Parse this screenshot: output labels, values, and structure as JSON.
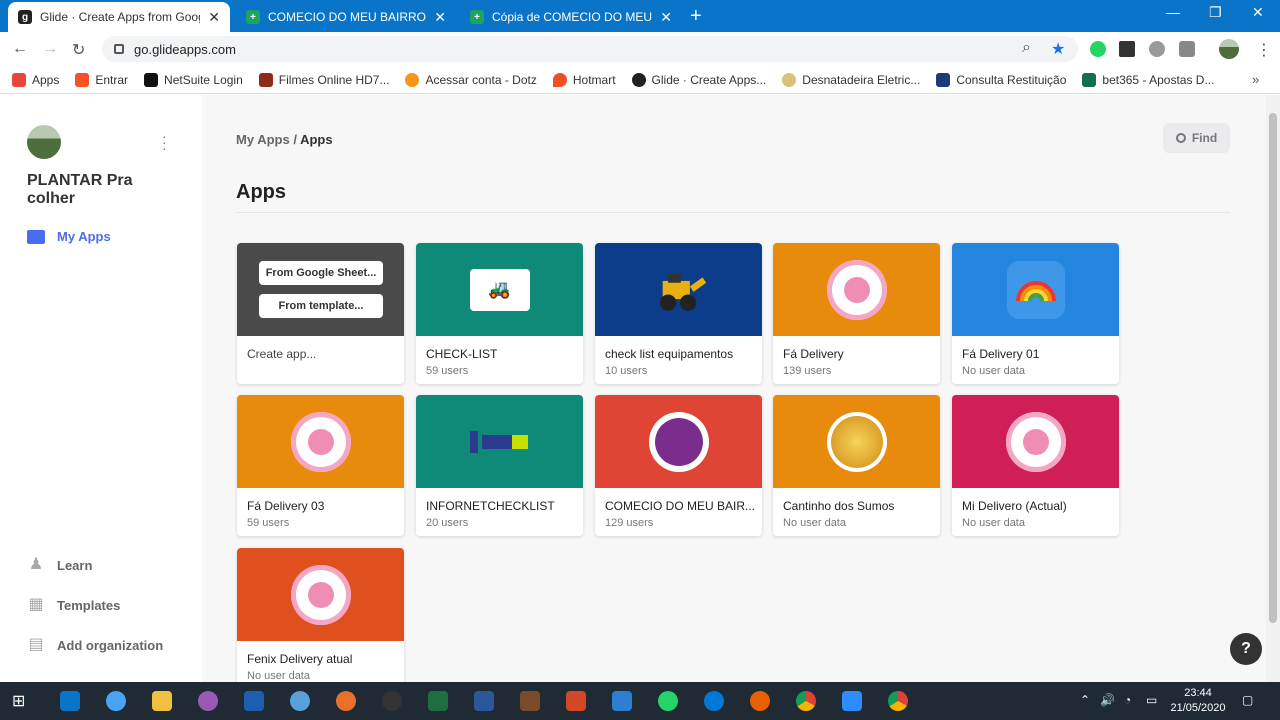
{
  "browser": {
    "tabs": [
      {
        "title": "Glide · Create Apps from Google",
        "favicon": "glide-icon",
        "active": true
      },
      {
        "title": "COMECIO DO MEU BAIRRO - Pla",
        "favicon": "sheets-icon",
        "active": false
      },
      {
        "title": "Cópia de COMECIO DO MEU BAI",
        "favicon": "sheets-icon",
        "active": false
      }
    ],
    "url": "go.glideapps.com",
    "bookmarks": [
      {
        "label": "Apps",
        "icon": "apps-grid-icon",
        "color": "#e8453c"
      },
      {
        "label": "Entrar",
        "icon": "microsoft-icon",
        "color": "#f35325"
      },
      {
        "label": "NetSuite Login",
        "icon": "netsuite-icon",
        "color": "#111111"
      },
      {
        "label": "Filmes Online HD7...",
        "icon": "film-icon",
        "color": "#8b2d1b"
      },
      {
        "label": "Acessar conta - Dotz",
        "icon": "dotz-icon",
        "color": "#f7941d"
      },
      {
        "label": "Hotmart",
        "icon": "hotmart-icon",
        "color": "#f04e23"
      },
      {
        "label": "Glide · Create Apps...",
        "icon": "glide-icon",
        "color": "#222222"
      },
      {
        "label": "Desnatadeira Eletric...",
        "icon": "bowl-icon",
        "color": "#d9c27a"
      },
      {
        "label": "Consulta Restituição",
        "icon": "receita-icon",
        "color": "#1f3a7a"
      },
      {
        "label": "bet365 - Apostas D...",
        "icon": "bet365-icon",
        "color": "#126e51"
      }
    ]
  },
  "sidebar": {
    "org_name": "PLANTAR Pra colher",
    "my_apps_label": "My Apps",
    "bottom_items": [
      {
        "label": "Learn",
        "icon": "learn-icon"
      },
      {
        "label": "Templates",
        "icon": "templates-icon"
      },
      {
        "label": "Add organization",
        "icon": "add-organization-icon"
      }
    ]
  },
  "header": {
    "breadcrumb_root": "My Apps",
    "breadcrumb_sep": " / ",
    "breadcrumb_current": "Apps",
    "find_label": "Find",
    "page_title": "Apps"
  },
  "create_card": {
    "from_sheet_label": "From Google Sheet...",
    "from_template_label": "From template...",
    "label": "Create app..."
  },
  "apps": [
    {
      "name": "CHECK-LIST",
      "users": "59 users",
      "bg": "#0f8a78"
    },
    {
      "name": "check list equipamentos",
      "users": "10 users",
      "bg": "#0c3d8a"
    },
    {
      "name": "Fá Delivery",
      "users": "139 users",
      "bg": "#e88b0c"
    },
    {
      "name": "Fá Delivery 01",
      "users": "No user data",
      "bg": "#2586e0"
    },
    {
      "name": "Fá Delivery 03",
      "users": "59 users",
      "bg": "#e88b0c"
    },
    {
      "name": "INFORNETCHECKLIST",
      "users": "20 users",
      "bg": "#0f8a78"
    },
    {
      "name": "COMECIO DO MEU BAIR...",
      "users": "129 users",
      "bg": "#e04434"
    },
    {
      "name": "Cantinho dos Sumos",
      "users": "No user data",
      "bg": "#e88b0c"
    },
    {
      "name": "Mi Delivero (Actual)",
      "users": "No user data",
      "bg": "#d01e57"
    },
    {
      "name": "Fenix Delivery atual",
      "users": "No user data",
      "bg": "#e0501e"
    }
  ],
  "help_label": "?",
  "taskbar": {
    "time": "23:44",
    "date": "21/05/2020"
  }
}
